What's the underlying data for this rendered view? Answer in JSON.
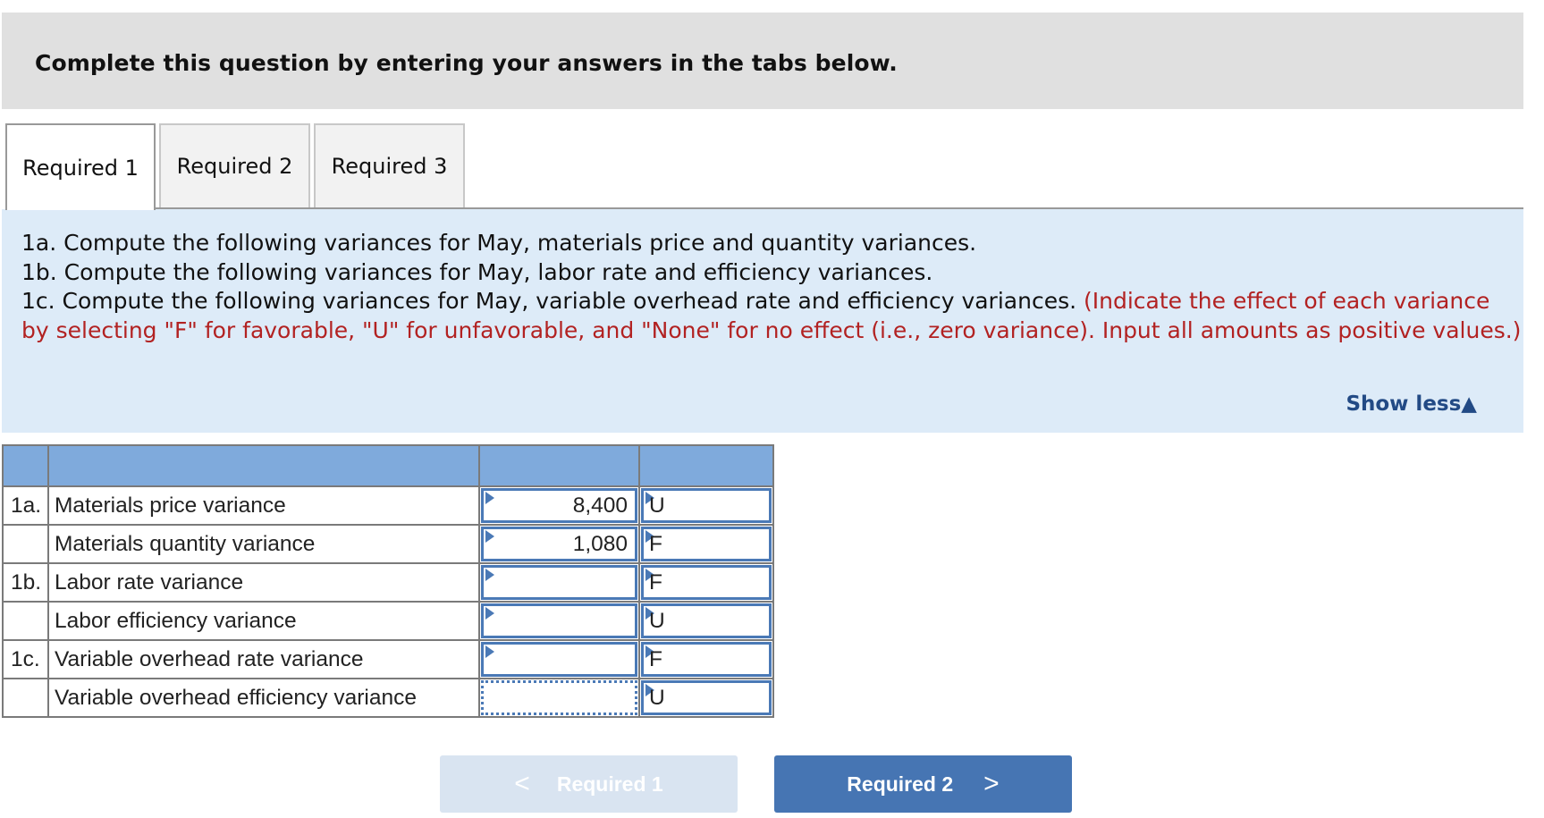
{
  "header": {
    "title": "Complete this question by entering your answers in the tabs below."
  },
  "tabs": [
    {
      "label": "Required 1",
      "active": true
    },
    {
      "label": "Required 2",
      "active": false
    },
    {
      "label": "Required 3",
      "active": false
    }
  ],
  "instructions": {
    "line_1a": "1a. Compute the following variances for May, materials price and quantity variances.",
    "line_1b": "1b. Compute the following variances for May, labor rate and efficiency variances.",
    "line_1c": "1c. Compute the following variances for May, variable overhead rate and efficiency variances.",
    "note": "(Indicate the effect of each variance by selecting \"F\" for favorable, \"U\" for unfavorable, and \"None\" for no effect (i.e., zero variance). Input all amounts as positive values.)",
    "show_less": "Show less",
    "show_less_icon": "triangle-up-icon"
  },
  "table": {
    "rows": [
      {
        "section": "1a.",
        "label": "Materials price variance",
        "amount": "8,400",
        "effect": "U"
      },
      {
        "section": "",
        "label": "Materials quantity variance",
        "amount": "1,080",
        "effect": "F"
      },
      {
        "section": "1b.",
        "label": "Labor rate variance",
        "amount": "",
        "effect": "F"
      },
      {
        "section": "",
        "label": "Labor efficiency variance",
        "amount": "",
        "effect": "U"
      },
      {
        "section": "1c.",
        "label": "Variable overhead rate variance",
        "amount": "",
        "effect": "F"
      },
      {
        "section": "",
        "label": "Variable overhead efficiency variance",
        "amount": "",
        "effect": "U"
      }
    ]
  },
  "nav": {
    "prev_label": "Required 1",
    "next_label": "Required 2",
    "prev_icon": "chevron-left-icon",
    "next_icon": "chevron-right-icon"
  },
  "colors": {
    "header_bg": "#e0e0e0",
    "instr_bg": "#ddebf8",
    "note_red": "#b22222",
    "link_blue": "#224a85",
    "table_header": "#7faadc",
    "input_border": "#4a79b6",
    "next_btn": "#4675b3",
    "prev_btn_disabled": "#d9e4f1"
  }
}
